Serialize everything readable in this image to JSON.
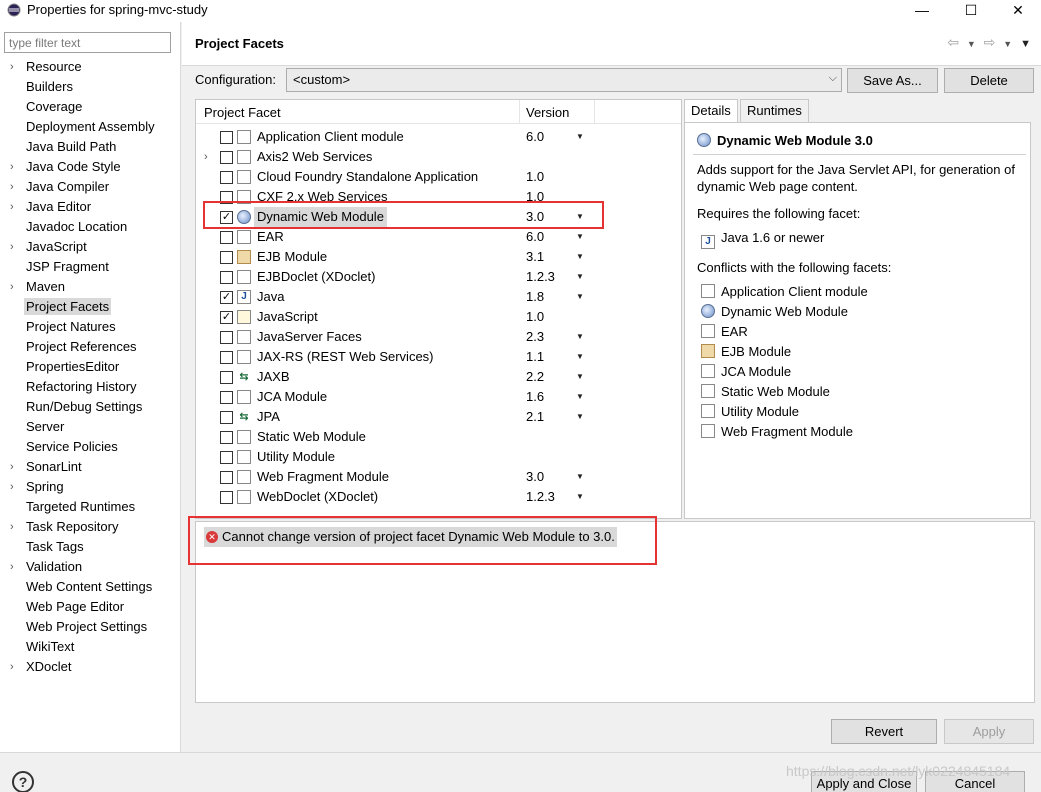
{
  "window": {
    "title": "Properties for spring-mvc-study",
    "minimize": "—",
    "maximize": "☐",
    "close": "✕"
  },
  "sidebar": {
    "filter_placeholder": "type filter text",
    "items": [
      {
        "label": "Resource",
        "expandable": true
      },
      {
        "label": "Builders",
        "expandable": false
      },
      {
        "label": "Coverage",
        "expandable": false
      },
      {
        "label": "Deployment Assembly",
        "expandable": false
      },
      {
        "label": "Java Build Path",
        "expandable": false
      },
      {
        "label": "Java Code Style",
        "expandable": true
      },
      {
        "label": "Java Compiler",
        "expandable": true
      },
      {
        "label": "Java Editor",
        "expandable": true
      },
      {
        "label": "Javadoc Location",
        "expandable": false
      },
      {
        "label": "JavaScript",
        "expandable": true
      },
      {
        "label": "JSP Fragment",
        "expandable": false
      },
      {
        "label": "Maven",
        "expandable": true
      },
      {
        "label": "Project Facets",
        "expandable": false,
        "selected": true
      },
      {
        "label": "Project Natures",
        "expandable": false
      },
      {
        "label": "Project References",
        "expandable": false
      },
      {
        "label": "PropertiesEditor",
        "expandable": false
      },
      {
        "label": "Refactoring History",
        "expandable": false
      },
      {
        "label": "Run/Debug Settings",
        "expandable": false
      },
      {
        "label": "Server",
        "expandable": false
      },
      {
        "label": "Service Policies",
        "expandable": false
      },
      {
        "label": "SonarLint",
        "expandable": true
      },
      {
        "label": "Spring",
        "expandable": true
      },
      {
        "label": "Targeted Runtimes",
        "expandable": false
      },
      {
        "label": "Task Repository",
        "expandable": true
      },
      {
        "label": "Task Tags",
        "expandable": false
      },
      {
        "label": "Validation",
        "expandable": true
      },
      {
        "label": "Web Content Settings",
        "expandable": false
      },
      {
        "label": "Web Page Editor",
        "expandable": false
      },
      {
        "label": "Web Project Settings",
        "expandable": false
      },
      {
        "label": "WikiText",
        "expandable": false
      },
      {
        "label": "XDoclet",
        "expandable": true
      }
    ]
  },
  "header": {
    "title": "Project Facets",
    "back_icon": "⇦",
    "forward_icon": "⇨",
    "menu_icon": "▾"
  },
  "configuration": {
    "label": "Configuration:",
    "value": "<custom>",
    "save_as": "Save As...",
    "delete": "Delete"
  },
  "facets": {
    "col_facet": "Project Facet",
    "col_version": "Version",
    "rows": [
      {
        "name": "Application Client module",
        "version": "6.0",
        "checked": false,
        "dropdown": true,
        "icon": "page",
        "expandable": false
      },
      {
        "name": "Axis2 Web Services",
        "version": "",
        "checked": false,
        "dropdown": false,
        "icon": "page",
        "expandable": true
      },
      {
        "name": "Cloud Foundry Standalone Application",
        "version": "1.0",
        "checked": false,
        "dropdown": false,
        "icon": "page",
        "expandable": false
      },
      {
        "name": "CXF 2.x Web Services",
        "version": "1.0",
        "checked": false,
        "dropdown": false,
        "icon": "page",
        "expandable": false
      },
      {
        "name": "Dynamic Web Module",
        "version": "3.0",
        "checked": true,
        "dropdown": true,
        "icon": "globe",
        "expandable": false,
        "selected": true
      },
      {
        "name": "EAR",
        "version": "6.0",
        "checked": false,
        "dropdown": true,
        "icon": "page",
        "expandable": false
      },
      {
        "name": "EJB Module",
        "version": "3.1",
        "checked": false,
        "dropdown": true,
        "icon": "jar",
        "expandable": false
      },
      {
        "name": "EJBDoclet (XDoclet)",
        "version": "1.2.3",
        "checked": false,
        "dropdown": true,
        "icon": "page",
        "expandable": false
      },
      {
        "name": "Java",
        "version": "1.8",
        "checked": true,
        "dropdown": true,
        "icon": "java",
        "expandable": false
      },
      {
        "name": "JavaScript",
        "version": "1.0",
        "checked": true,
        "dropdown": false,
        "icon": "js",
        "expandable": false
      },
      {
        "name": "JavaServer Faces",
        "version": "2.3",
        "checked": false,
        "dropdown": true,
        "icon": "page",
        "expandable": false
      },
      {
        "name": "JAX-RS (REST Web Services)",
        "version": "1.1",
        "checked": false,
        "dropdown": true,
        "icon": "page",
        "expandable": false
      },
      {
        "name": "JAXB",
        "version": "2.2",
        "checked": false,
        "dropdown": true,
        "icon": "ws",
        "expandable": false
      },
      {
        "name": "JCA Module",
        "version": "1.6",
        "checked": false,
        "dropdown": true,
        "icon": "page",
        "expandable": false
      },
      {
        "name": "JPA",
        "version": "2.1",
        "checked": false,
        "dropdown": true,
        "icon": "ws",
        "expandable": false
      },
      {
        "name": "Static Web Module",
        "version": "",
        "checked": false,
        "dropdown": false,
        "icon": "page",
        "expandable": false
      },
      {
        "name": "Utility Module",
        "version": "",
        "checked": false,
        "dropdown": false,
        "icon": "page",
        "expandable": false
      },
      {
        "name": "Web Fragment Module",
        "version": "3.0",
        "checked": false,
        "dropdown": true,
        "icon": "page",
        "expandable": false
      },
      {
        "name": "WebDoclet (XDoclet)",
        "version": "1.2.3",
        "checked": false,
        "dropdown": true,
        "icon": "page",
        "expandable": false
      }
    ]
  },
  "details": {
    "tab_details": "Details",
    "tab_runtimes": "Runtimes",
    "title": "Dynamic Web Module 3.0",
    "description": "Adds support for the Java Servlet API, for generation of dynamic Web page content.",
    "requires_label": "Requires the following facet:",
    "requires": [
      {
        "name": "Java 1.6 or newer",
        "icon": "java"
      }
    ],
    "conflicts_label": "Conflicts with the following facets:",
    "conflicts": [
      {
        "name": "Application Client module",
        "icon": "page"
      },
      {
        "name": "Dynamic Web Module",
        "icon": "globe"
      },
      {
        "name": "EAR",
        "icon": "page"
      },
      {
        "name": "EJB Module",
        "icon": "jar"
      },
      {
        "name": "JCA Module",
        "icon": "page"
      },
      {
        "name": "Static Web Module",
        "icon": "page"
      },
      {
        "name": "Utility Module",
        "icon": "page"
      },
      {
        "name": "Web Fragment Module",
        "icon": "page"
      }
    ]
  },
  "message": {
    "text": "Cannot change version of project facet Dynamic Web Module to 3.0.",
    "icon": "error-icon"
  },
  "buttons": {
    "revert": "Revert",
    "apply": "Apply",
    "apply_and_close": "Apply and Close",
    "cancel": "Cancel"
  },
  "watermark": "https://blog.csdn.net/lyk0224845184",
  "colors": {
    "highlight_border": "#e53333",
    "selection": "#d9d9d9",
    "error": "#d83a3a"
  }
}
